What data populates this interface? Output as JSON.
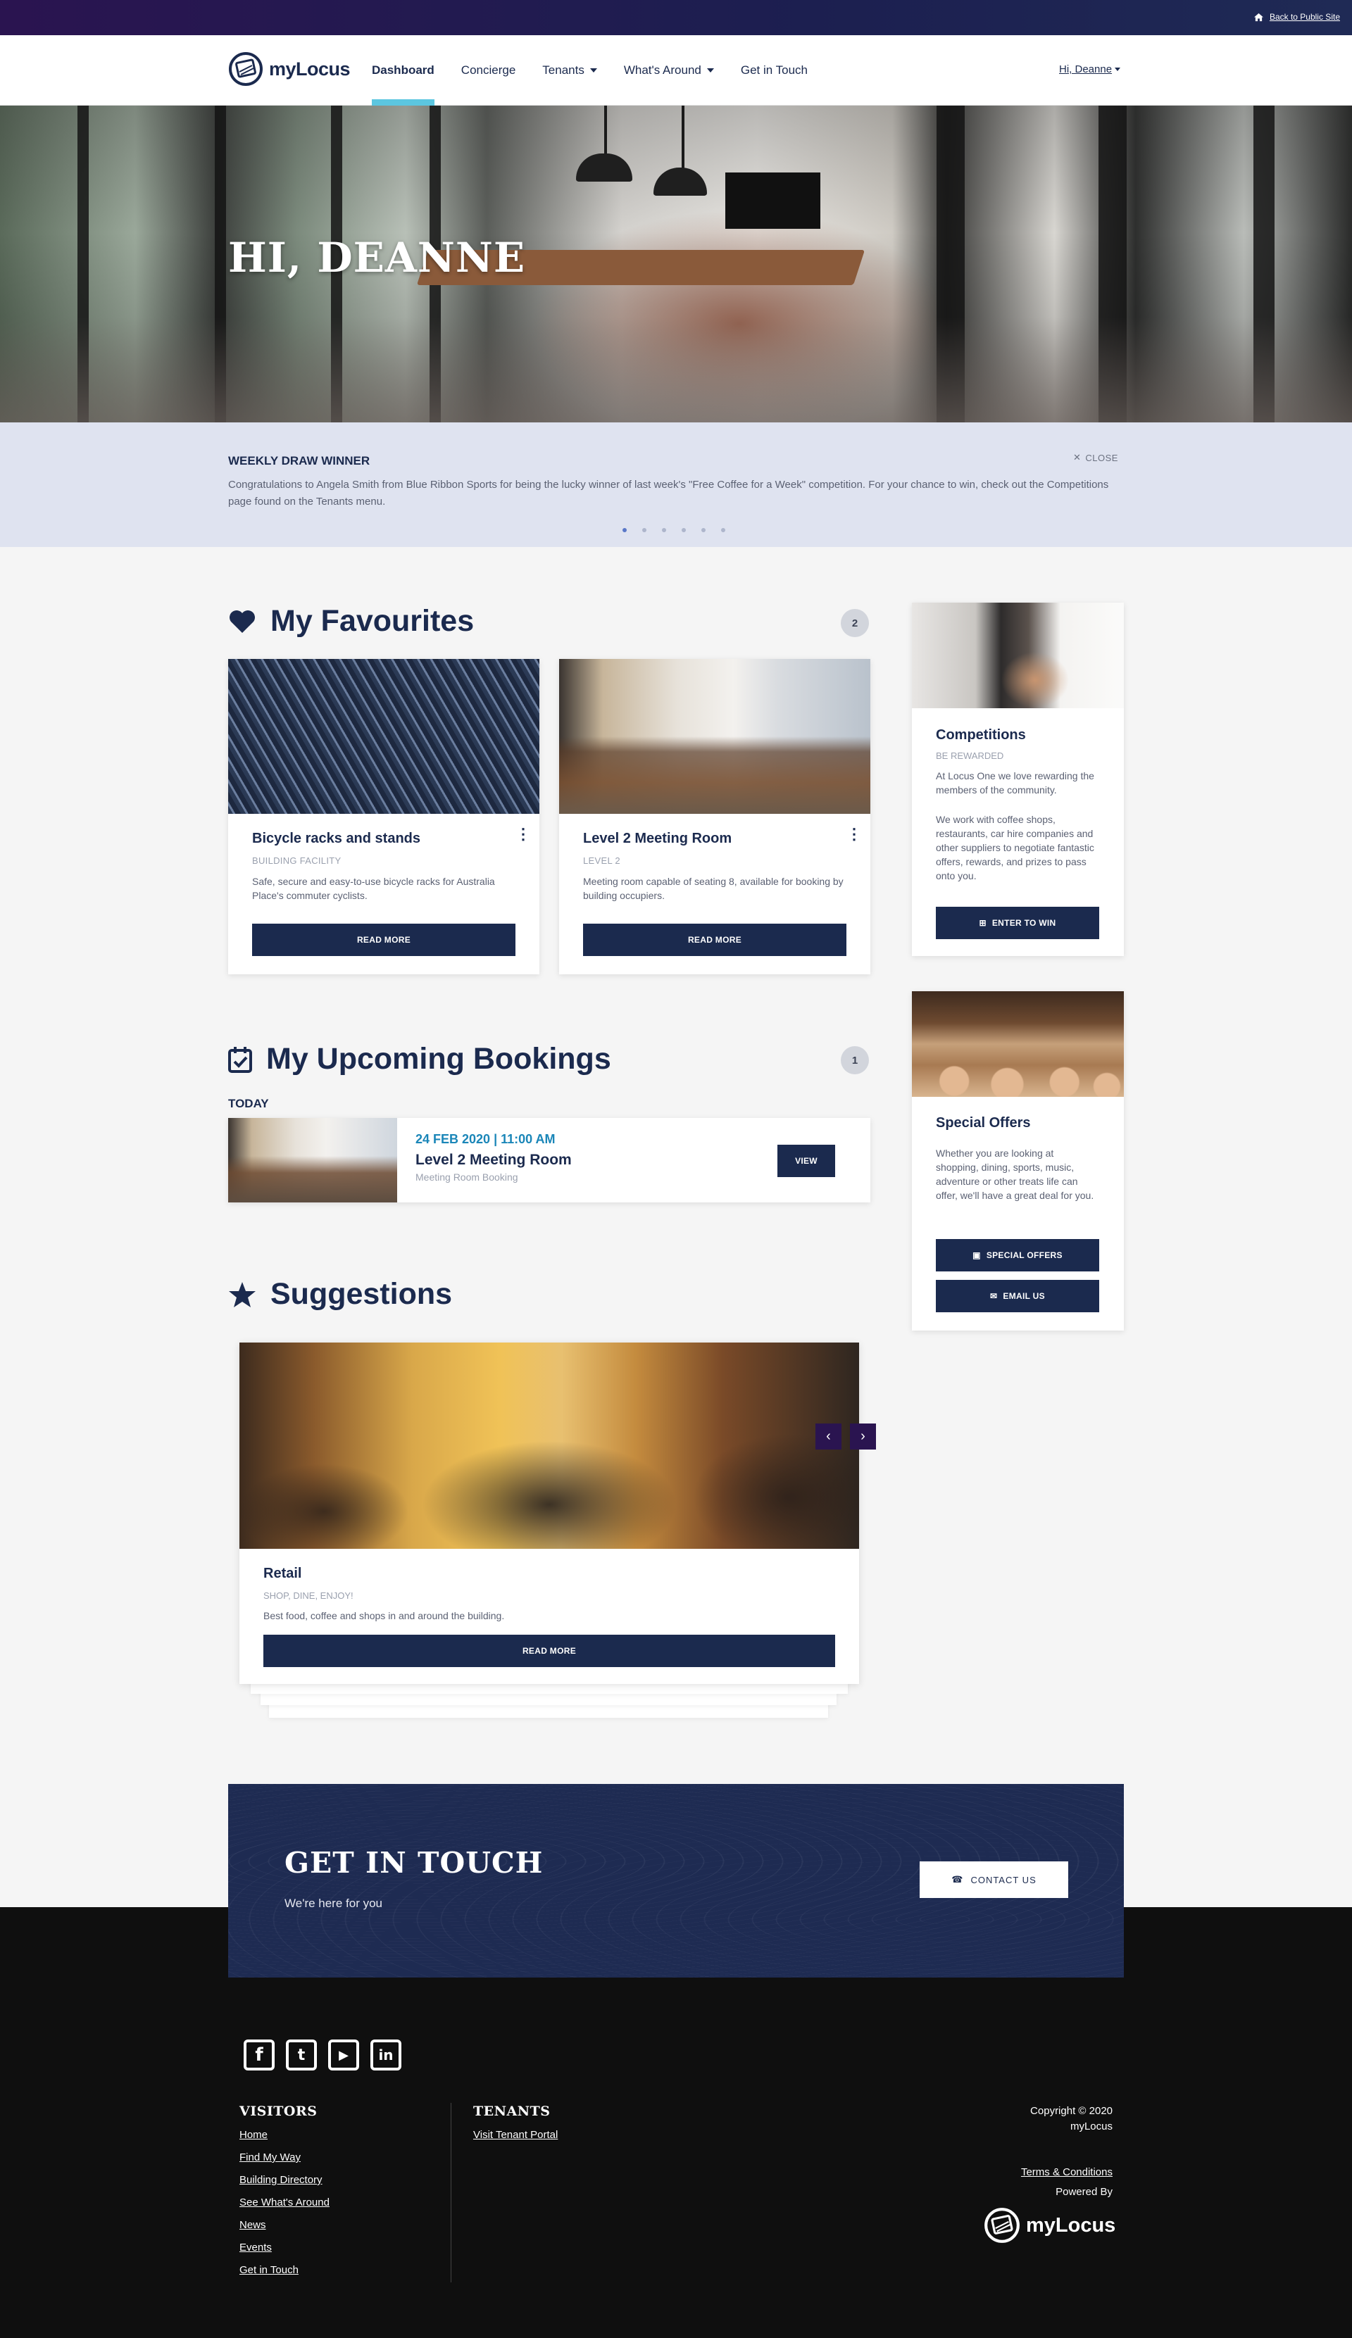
{
  "topbar": {
    "back_label": "Back to Public Site",
    "icon": "home-icon"
  },
  "header": {
    "logo_text": "myLocus",
    "nav": [
      {
        "label": "Dashboard",
        "active": true,
        "dropdown": false
      },
      {
        "label": "Concierge",
        "active": false,
        "dropdown": false
      },
      {
        "label": "Tenants",
        "active": false,
        "dropdown": true
      },
      {
        "label": "What's Around",
        "active": false,
        "dropdown": true
      },
      {
        "label": "Get in Touch",
        "active": false,
        "dropdown": false
      }
    ],
    "user_label": "Hi, Deanne"
  },
  "hero": {
    "greeting": "HI, DEANNE"
  },
  "notice": {
    "title": "WEEKLY DRAW WINNER",
    "body": "Congratulations to Angela Smith from Blue Ribbon Sports for being the lucky winner of last week's \"Free Coffee for a Week\" competition. For your chance to win, check out the Competitions page found on the Tenants menu.",
    "close_label": "CLOSE",
    "slide_count": 6,
    "active_slide": 1
  },
  "favourites": {
    "title": "My Favourites",
    "count": "2",
    "items": [
      {
        "title": "Bicycle racks and stands",
        "category": "BUILDING FACILITY",
        "description": "Safe, secure and easy-to-use bicycle racks for Australia Place's commuter cyclists.",
        "button": "READ MORE"
      },
      {
        "title": "Level 2 Meeting Room",
        "category": "LEVEL 2",
        "description": "Meeting room capable of seating 8, available for booking by building occupiers.",
        "button": "READ MORE"
      }
    ]
  },
  "bookings": {
    "title": "My Upcoming Bookings",
    "count": "1",
    "group_label": "TODAY",
    "items": [
      {
        "datetime": "24 FEB 2020 | 11:00 AM",
        "name": "Level 2 Meeting Room",
        "type": "Meeting Room Booking",
        "button": "VIEW"
      }
    ]
  },
  "suggestions": {
    "title": "Suggestions",
    "item": {
      "title": "Retail",
      "subtitle": "SHOP, DINE, ENJOY!",
      "description": "Best food, coffee and shops in and around the building.",
      "button": "READ MORE"
    }
  },
  "sidebar": {
    "competitions": {
      "title": "Competitions",
      "subtitle": "BE REWARDED",
      "p1": "At Locus One we love rewarding the members of the community.",
      "p2": "We work with coffee shops, restaurants, car hire companies and other suppliers to negotiate fantastic offers, rewards, and prizes to pass onto you.",
      "button": "ENTER TO WIN"
    },
    "offers": {
      "title": "Special Offers",
      "p": "Whether you are looking at shopping, dining, sports, music, adventure or other treats life can offer, we'll have a great deal for you.",
      "button1": "SPECIAL OFFERS",
      "button2": "EMAIL US"
    }
  },
  "get_in_touch": {
    "title": "GET IN TOUCH",
    "tagline": "We're here for you",
    "button": "CONTACT US"
  },
  "footer": {
    "social": [
      "facebook-icon",
      "twitter-icon",
      "youtube-icon",
      "linkedin-icon"
    ],
    "visitors": {
      "heading": "VISITORS",
      "links": [
        "Home",
        "Find My Way",
        "Building Directory",
        "See What's Around",
        "News",
        "Events",
        "Get in Touch"
      ]
    },
    "tenants": {
      "heading": "TENANTS",
      "links": [
        "Visit Tenant Portal"
      ]
    },
    "copyright_line1": "Copyright © 2020",
    "copyright_line2": "myLocus",
    "terms": "Terms & Conditions",
    "powered_by": "Powered By",
    "brand": "myLocus"
  },
  "colors": {
    "navy": "#1b2a4e",
    "accent": "#5cc6e0",
    "date_blue": "#1a86b8",
    "top_gradient": "#2a1450"
  }
}
